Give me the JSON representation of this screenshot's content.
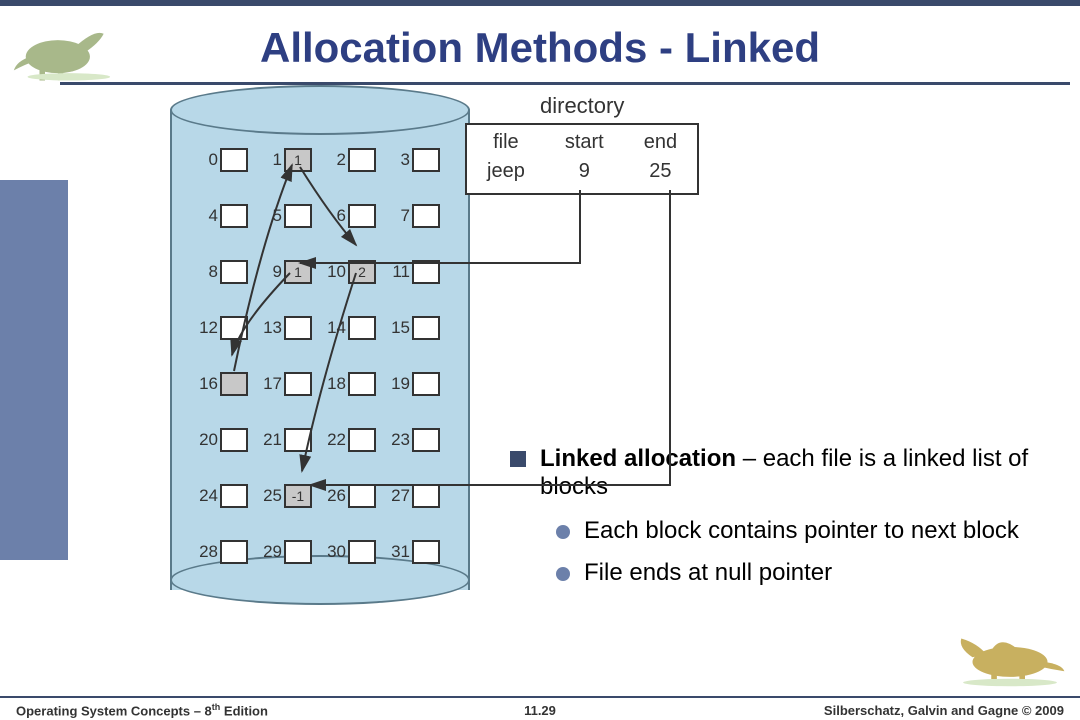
{
  "title": "Allocation Methods - Linked",
  "directory": {
    "label": "directory",
    "cols": {
      "file_hdr": "file",
      "file_val": "jeep",
      "start_hdr": "start",
      "start_val": "9",
      "end_hdr": "end",
      "end_val": "25"
    }
  },
  "blocks": {
    "b0": "0",
    "b1": "1",
    "b2": "2",
    "b3": "3",
    "b4": "4",
    "b5": "5",
    "b6": "6",
    "b7": "7",
    "b8": "8",
    "b9": "9",
    "b10": "10",
    "b11": "11",
    "b12": "12",
    "b13": "13",
    "b14": "14",
    "b15": "15",
    "b16": "16",
    "b17": "17",
    "b18": "18",
    "b19": "19",
    "b20": "20",
    "b21": "21",
    "b22": "22",
    "b23": "23",
    "b24": "24",
    "b25": "25",
    "b26": "26",
    "b27": "27",
    "b28": "28",
    "b29": "29",
    "b30": "30",
    "b31": "31"
  },
  "block_values": {
    "v1": "1",
    "v9": "1",
    "v10": "2",
    "v25": "-1"
  },
  "notes": {
    "main_bold": "Linked allocation",
    "main_rest": " – each file is a linked list of blocks",
    "sub1": "Each block contains pointer to next block",
    "sub2": "File ends at null pointer"
  },
  "footer": {
    "left_a": "Operating System Concepts  – 8",
    "left_sup": "th",
    "left_b": " Edition",
    "center": "11.29",
    "right": "Silberschatz, Galvin and Gagne © 2009"
  },
  "chart_data": {
    "type": "table",
    "description": "Linked allocation example on a 32-block disk. Directory entry: file 'jeep', start block 9, end block 25. Linked list of blocks (block → pointer-to-next): 9 → 16, 16 → 1, 1 → 10, 10 → 25, 25 → -1 (end).",
    "disk_block_count": 32,
    "directory": [
      {
        "file": "jeep",
        "start": 9,
        "end": 25
      }
    ],
    "linked_chain": [
      9,
      16,
      1,
      10,
      25
    ],
    "block_pointers": {
      "9": 16,
      "16": 1,
      "1": 10,
      "10": 25,
      "25": -1
    }
  }
}
